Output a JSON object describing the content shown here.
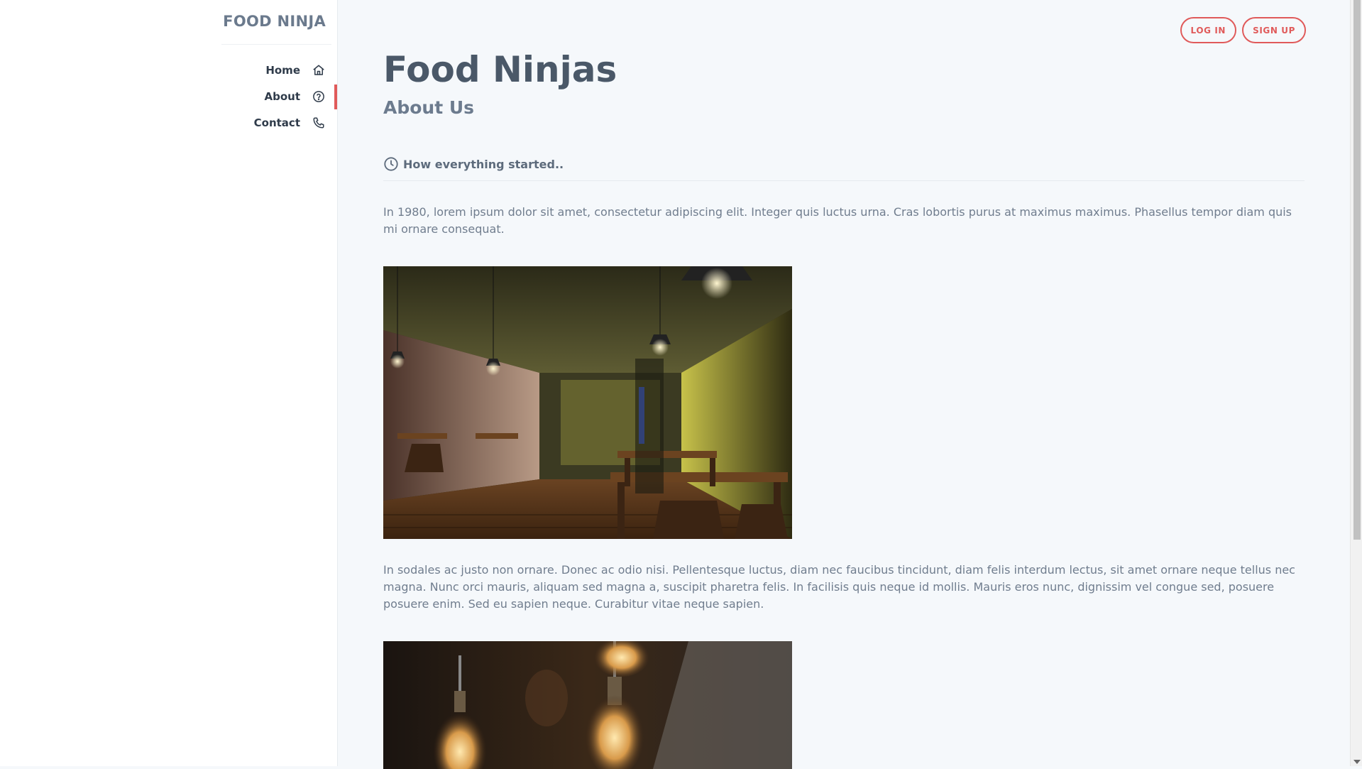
{
  "sidebar": {
    "brand": "FOOD NINJA",
    "items": [
      {
        "label": "Home",
        "icon": "home-icon"
      },
      {
        "label": "About",
        "icon": "help-circle-icon",
        "active": true
      },
      {
        "label": "Contact",
        "icon": "phone-icon"
      }
    ]
  },
  "header": {
    "login_label": "LOG IN",
    "signup_label": "SIGN UP"
  },
  "main": {
    "title": "Food Ninjas",
    "subtitle": "About Us",
    "section_heading": "How everything started..",
    "section_icon": "clock-icon",
    "paragraph_1": "In 1980, lorem ipsum dolor sit amet, consectetur adipiscing elit. Integer quis luctus urna. Cras lobortis purus at maximus maximus. Phasellus tempor diam quis mi ornare consequat.",
    "paragraph_2": "In sodales ac justo non ornare. Donec ac odio nisi. Pellentesque luctus, diam nec faucibus tincidunt, diam felis interdum lectus, sit amet ornare neque tellus nec magna. Nunc orci mauris, aliquam sed magna a, suscipit pharetra felis. In facilisis quis neque id mollis. Mauris eros nunc, dignissim vel congue sed, posuere posuere enim. Sed eu sapien neque. Curabitur vitae neque sapien."
  },
  "colors": {
    "accent": "#e05a5a",
    "text_dark": "#2f3b4a",
    "background": "#f5f8fb"
  }
}
